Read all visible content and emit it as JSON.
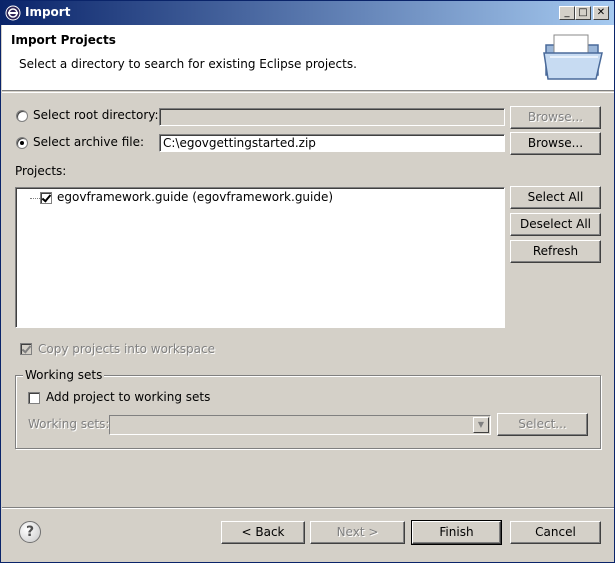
{
  "window": {
    "title": "Import",
    "minimize": "_",
    "maximize": "□",
    "close": "✕"
  },
  "header": {
    "title": "Import Projects",
    "description": "Select a directory to search for existing Eclipse projects."
  },
  "source": {
    "root_directory_label": "Select root directory:",
    "root_directory_value": "",
    "root_browse_label": "Browse...",
    "archive_file_label": "Select archive file:",
    "archive_file_value": "C:\\egovgettingstarted.zip",
    "archive_browse_label": "Browse...",
    "selected_option": "archive"
  },
  "projects": {
    "label": "Projects:",
    "items": [
      {
        "name": "egovframework.guide (egovframework.guide)",
        "checked": true
      }
    ],
    "select_all_label": "Select All",
    "deselect_all_label": "Deselect All",
    "refresh_label": "Refresh"
  },
  "copy_projects": {
    "label": "Copy projects into workspace",
    "checked": true,
    "enabled": false
  },
  "working_sets": {
    "group_label": "Working sets",
    "add_label": "Add project to working sets",
    "add_checked": false,
    "sets_label": "Working sets:",
    "sets_value": "",
    "select_label": "Select..."
  },
  "footer": {
    "help_icon": "?",
    "back_label": "< Back",
    "next_label": "Next >",
    "finish_label": "Finish",
    "cancel_label": "Cancel"
  }
}
